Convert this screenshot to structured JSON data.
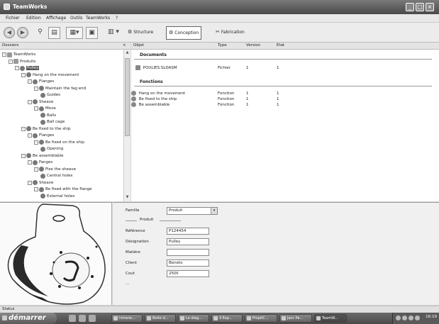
{
  "window": {
    "title": "TeamWorks"
  },
  "menu": [
    "Fichier",
    "Edition",
    "Affichage",
    "Outils",
    "TeamWorks",
    "?"
  ],
  "toolbar": {
    "tabs": [
      {
        "label": "Structure",
        "icon": "structure-icon"
      },
      {
        "label": "Conception",
        "icon": "conception-icon"
      },
      {
        "label": "Fabrication",
        "icon": "fabrication-icon"
      }
    ]
  },
  "folders_header": "Dossiers",
  "object_columns": [
    "Objet",
    "Type",
    "Version",
    "Etat"
  ],
  "tree": [
    {
      "label": "TeamWorks",
      "depth": 0,
      "toggle": "-",
      "icon": "folder"
    },
    {
      "label": "Produits",
      "depth": 1,
      "toggle": "-",
      "icon": "folder"
    },
    {
      "label": "Pulley",
      "depth": 2,
      "toggle": "-",
      "icon": "part",
      "selected": true
    },
    {
      "label": "Hang on the movement",
      "depth": 3,
      "toggle": "-",
      "icon": "function"
    },
    {
      "label": "Flanges",
      "depth": 4,
      "toggle": "-",
      "icon": "part"
    },
    {
      "label": "Maintain the fag end",
      "depth": 5,
      "toggle": "-",
      "icon": "function"
    },
    {
      "label": "Guides",
      "depth": 6,
      "toggle": "",
      "icon": "part"
    },
    {
      "label": "Sheave",
      "depth": 4,
      "toggle": "-",
      "icon": "part"
    },
    {
      "label": "Move",
      "depth": 5,
      "toggle": "-",
      "icon": "function"
    },
    {
      "label": "Balls",
      "depth": 6,
      "toggle": "",
      "icon": "part"
    },
    {
      "label": "Ball cage",
      "depth": 6,
      "toggle": "",
      "icon": "part"
    },
    {
      "label": "Be fixed to the ship",
      "depth": 3,
      "toggle": "-",
      "icon": "function"
    },
    {
      "label": "Flanges",
      "depth": 4,
      "toggle": "-",
      "icon": "part"
    },
    {
      "label": "Be fixed on the ship",
      "depth": 5,
      "toggle": "-",
      "icon": "function"
    },
    {
      "label": "Opening",
      "depth": 6,
      "toggle": "",
      "icon": "part"
    },
    {
      "label": "Be assemblable",
      "depth": 3,
      "toggle": "-",
      "icon": "function"
    },
    {
      "label": "Fanges",
      "depth": 4,
      "toggle": "-",
      "icon": "part"
    },
    {
      "label": "Fixe the sheave",
      "depth": 5,
      "toggle": "-",
      "icon": "function"
    },
    {
      "label": "Central holes",
      "depth": 6,
      "toggle": "",
      "icon": "part"
    },
    {
      "label": "Sheave",
      "depth": 4,
      "toggle": "-",
      "icon": "part"
    },
    {
      "label": "Be fixed with the flange",
      "depth": 5,
      "toggle": "-",
      "icon": "function"
    },
    {
      "label": "External holes",
      "depth": 6,
      "toggle": "",
      "icon": "part"
    }
  ],
  "documents": {
    "title": "Documents",
    "rows": [
      {
        "name": "POULIES.SLDASM",
        "type": "Fichier",
        "version": "1",
        "etat": "1"
      }
    ]
  },
  "fonctions": {
    "title": "Fonctions",
    "rows": [
      {
        "name": "Hang on the movement",
        "type": "Fonction",
        "version": "1",
        "etat": "1"
      },
      {
        "name": "Be fixed to the ship",
        "type": "Fonction",
        "version": "1",
        "etat": "1"
      },
      {
        "name": "Be assemblable",
        "type": "Fonction",
        "version": "1",
        "etat": "1"
      }
    ]
  },
  "properties": {
    "famille_label": "Famille",
    "famille_value": "Produit",
    "group_label": "Produit",
    "fields": [
      {
        "label": "Référence",
        "value": "P124454"
      },
      {
        "label": "Désignation",
        "value": "Pulley"
      },
      {
        "label": "Matière",
        "value": ""
      },
      {
        "label": "Client",
        "value": "Beneto"
      },
      {
        "label": "Cout",
        "value": "250€"
      }
    ],
    "more": "..."
  },
  "status": "Status",
  "taskbar": {
    "start": "démarrer",
    "tasks": [
      "Intrane...",
      "Boite d...",
      "Le diag...",
      "3 Exp...",
      "ProjetC...",
      "Jacc Pa...",
      "TeamW..."
    ],
    "clock": "16:19"
  }
}
